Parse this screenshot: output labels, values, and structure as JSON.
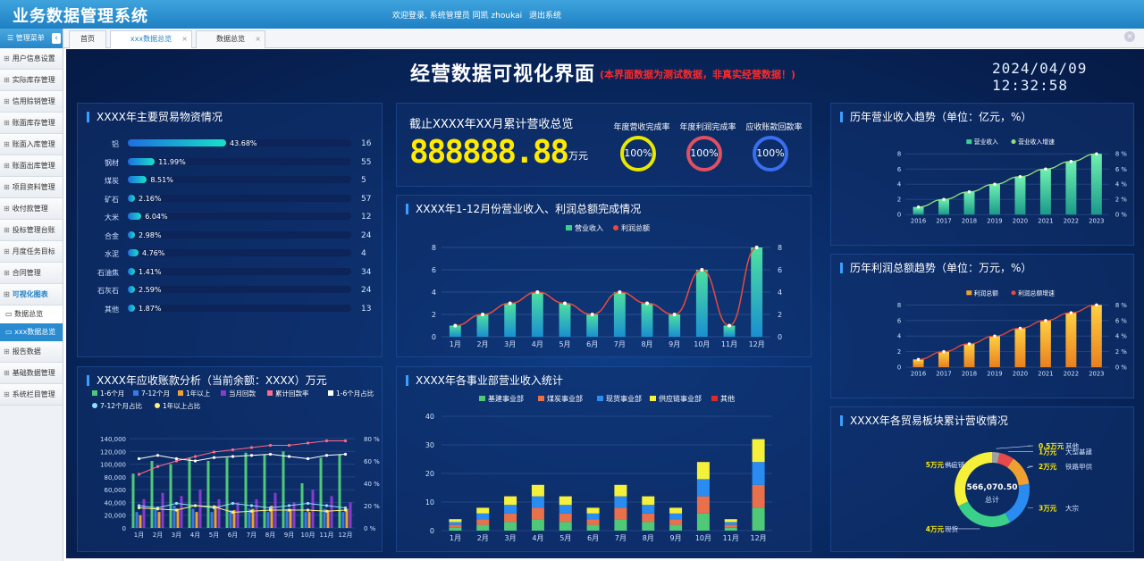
{
  "app": {
    "title": "业务数据管理系统",
    "welcome": "欢迎登录, 系统管理员 同凯 zhoukai",
    "logout": "退出系统"
  },
  "sidebar": {
    "header": "管理菜单",
    "collapse_icon": "chevron-left-icon",
    "items": [
      {
        "label": "用户信息设置"
      },
      {
        "label": "实际库存管理"
      },
      {
        "label": "信用赊销管理"
      },
      {
        "label": "账面库存管理"
      },
      {
        "label": "账面入库管理"
      },
      {
        "label": "账面出库管理"
      },
      {
        "label": "项目资料管理"
      },
      {
        "label": "收付款管理"
      },
      {
        "label": "投标管理台账"
      },
      {
        "label": "月度任务目标"
      },
      {
        "label": "合同管理"
      },
      {
        "label": "可视化图表"
      }
    ],
    "subitems": [
      {
        "label": "数据总览"
      },
      {
        "label": "xxx数据总览"
      }
    ],
    "items_after": [
      {
        "label": "报告数据"
      },
      {
        "label": "基础数据管理"
      },
      {
        "label": "系统栏目管理"
      }
    ]
  },
  "tabs": [
    {
      "label": "首页"
    },
    {
      "label": "xxx数据总览"
    },
    {
      "label": "数据总览"
    }
  ],
  "dashboard": {
    "title": "经营数据可视化界面",
    "note": "(本界面数据为测试数据，非真实经营数据！)",
    "datetime": "2024/04/09 12:32:58"
  },
  "materials": {
    "title": "XXXX年主要贸易物资情况",
    "rows": [
      {
        "name": "铝",
        "pct": 43.68,
        "pct_label": "43.68%",
        "count": "16"
      },
      {
        "name": "钢材",
        "pct": 11.99,
        "pct_label": "11.99%",
        "count": "55"
      },
      {
        "name": "煤炭",
        "pct": 8.51,
        "pct_label": "8.51%",
        "count": "5"
      },
      {
        "name": "矿石",
        "pct": 2.16,
        "pct_label": "2.16%",
        "count": "57"
      },
      {
        "name": "大米",
        "pct": 6.04,
        "pct_label": "6.04%",
        "count": "12"
      },
      {
        "name": "合金",
        "pct": 2.98,
        "pct_label": "2.98%",
        "count": "24"
      },
      {
        "name": "水泥",
        "pct": 4.76,
        "pct_label": "4.76%",
        "count": "4"
      },
      {
        "name": "石油焦",
        "pct": 1.41,
        "pct_label": "1.41%",
        "count": "34"
      },
      {
        "name": "石灰石",
        "pct": 2.59,
        "pct_label": "2.59%",
        "count": "24"
      },
      {
        "name": "其他",
        "pct": 1.87,
        "pct_label": "1.87%",
        "count": "13"
      }
    ]
  },
  "summary": {
    "label": "截止XXXX年XX月累计营收总览",
    "value": "888888.88",
    "unit": "万元",
    "rings": [
      {
        "label": "年度营收完成率",
        "value": "100%",
        "color": "#e8e800"
      },
      {
        "label": "年度利润完成率",
        "value": "100%",
        "color": "#e05060"
      },
      {
        "label": "应收账款回款率",
        "value": "100%",
        "color": "#3a6ef0"
      }
    ]
  },
  "chart_data": [
    {
      "type": "bar",
      "id": "monthly",
      "title": "XXXX年1-12月份营业收入、利润总额完成情况",
      "categories": [
        "1月",
        "2月",
        "3月",
        "4月",
        "5月",
        "6月",
        "7月",
        "8月",
        "9月",
        "10月",
        "11月",
        "12月"
      ],
      "series": [
        {
          "name": "营业收入",
          "type": "bar",
          "values": [
            1,
            2,
            3,
            4,
            3,
            2,
            4,
            3,
            2,
            6,
            1,
            8
          ]
        },
        {
          "name": "利润总额",
          "type": "line",
          "values": [
            1,
            2,
            3,
            4,
            3,
            2,
            4,
            3,
            2,
            6,
            1,
            8
          ]
        }
      ],
      "ylim": [
        0,
        8
      ],
      "yticks": [
        0,
        2,
        4,
        6,
        8
      ],
      "y2ticks": [
        0,
        2,
        4,
        6,
        8
      ],
      "legend": "top"
    },
    {
      "type": "bar",
      "id": "revenue_trend",
      "title": "历年营业收入趋势（单位：亿元，%）",
      "categories": [
        "2016",
        "2017",
        "2018",
        "2019",
        "2020",
        "2021",
        "2022",
        "2023"
      ],
      "series": [
        {
          "name": "营业收入",
          "type": "bar",
          "values": [
            1,
            2,
            3,
            4,
            5,
            6,
            7,
            8
          ]
        },
        {
          "name": "营业收入增速",
          "type": "line",
          "values": [
            1,
            2,
            3,
            4,
            5,
            6,
            7,
            8
          ]
        }
      ],
      "ylim": [
        0,
        8
      ],
      "yticks": [
        0,
        2,
        4,
        6,
        8
      ],
      "y2ticks": [
        "0 %",
        "2 %",
        "4 %",
        "6 %",
        "8 %"
      ],
      "legend": "top"
    },
    {
      "type": "bar",
      "id": "profit_trend",
      "title": "历年利润总额趋势（单位：万元，%）",
      "categories": [
        "2016",
        "2017",
        "2018",
        "2019",
        "2020",
        "2021",
        "2022",
        "2023"
      ],
      "series": [
        {
          "name": "利润总额",
          "type": "bar",
          "values": [
            1,
            2,
            3,
            4,
            5,
            6,
            7,
            8
          ]
        },
        {
          "name": "利润总额增速",
          "type": "line",
          "values": [
            1,
            2,
            3,
            4,
            5,
            6,
            7,
            8
          ]
        }
      ],
      "ylim": [
        0,
        8
      ],
      "yticks": [
        0,
        2,
        4,
        6,
        8
      ],
      "y2ticks": [
        "0 %",
        "2 %",
        "4 %",
        "6 %",
        "8 %"
      ],
      "legend": "top"
    },
    {
      "type": "bar",
      "id": "receivables",
      "title": "XXXX年应收账款分析（当前余额：XXXX）万元",
      "categories": [
        "1月",
        "2月",
        "3月",
        "4月",
        "5月",
        "6月",
        "7月",
        "8月",
        "9月",
        "10月",
        "11月",
        "12月"
      ],
      "series": [
        {
          "name": "1-6个月",
          "type": "bar",
          "color": "#4fc978",
          "values": [
            85000,
            105000,
            100000,
            110000,
            105000,
            110000,
            118000,
            115000,
            120000,
            70000,
            110000,
            115000
          ]
        },
        {
          "name": "7-12个月",
          "type": "bar",
          "color": "#3a78e6",
          "values": [
            25000,
            30000,
            35000,
            30000,
            25000,
            28000,
            30000,
            25000,
            30000,
            25000,
            30000,
            25000
          ]
        },
        {
          "name": "1年以上",
          "type": "bar",
          "color": "#f0a030",
          "values": [
            20000,
            25000,
            30000,
            25000,
            35000,
            28000,
            30000,
            35000,
            30000,
            25000,
            28000,
            30000
          ]
        },
        {
          "name": "当月回款",
          "type": "bar",
          "color": "#8a3ad0",
          "values": [
            45000,
            55000,
            50000,
            60000,
            45000,
            40000,
            45000,
            55000,
            40000,
            60000,
            50000,
            40000
          ]
        },
        {
          "name": "累计回款率",
          "type": "line",
          "color": "#ff6a8a",
          "values": [
            48,
            55,
            60,
            64,
            68,
            70,
            72,
            74,
            74,
            76,
            78,
            78
          ]
        },
        {
          "name": "1-6个月占比",
          "type": "line",
          "color": "#ffffff",
          "values": [
            62,
            65,
            62,
            60,
            63,
            64,
            65,
            66,
            64,
            62,
            65,
            66
          ]
        },
        {
          "name": "7-12个月占比",
          "type": "line",
          "color": "#8fe0ff",
          "values": [
            20,
            18,
            22,
            20,
            18,
            22,
            20,
            18,
            20,
            22,
            20,
            18
          ]
        },
        {
          "name": "1年以上占比",
          "type": "line",
          "color": "#fff080",
          "values": [
            18,
            17,
            16,
            20,
            19,
            14,
            15,
            16,
            16,
            16,
            15,
            16
          ]
        }
      ],
      "ylim": [
        0,
        140000
      ],
      "yticks": [
        "0",
        "20,000",
        "40,000",
        "60,000",
        "80,000",
        "100,000",
        "120,000",
        "140,000"
      ],
      "y2ticks": [
        "0 %",
        "20 %",
        "40 %",
        "60 %",
        "80 %"
      ],
      "legend": "top"
    },
    {
      "type": "bar",
      "stacked": true,
      "id": "divisions",
      "title": "XXXX年各事业部营业收入统计",
      "categories": [
        "1月",
        "2月",
        "3月",
        "4月",
        "5月",
        "6月",
        "7月",
        "8月",
        "9月",
        "10月",
        "11月",
        "12月"
      ],
      "series": [
        {
          "name": "基建事业部",
          "color": "#4fc978",
          "values": [
            1,
            2,
            3,
            4,
            3,
            2,
            4,
            3,
            2,
            6,
            1,
            8
          ]
        },
        {
          "name": "煤炭事业部",
          "color": "#e8704a",
          "values": [
            1,
            2,
            3,
            4,
            3,
            2,
            4,
            3,
            2,
            6,
            1,
            8
          ]
        },
        {
          "name": "现货事业部",
          "color": "#2a8bf0",
          "values": [
            1,
            2,
            3,
            4,
            3,
            2,
            4,
            3,
            2,
            6,
            1,
            8
          ]
        },
        {
          "name": "供应链事业部",
          "color": "#f5f03a",
          "values": [
            1,
            2,
            3,
            4,
            3,
            2,
            4,
            3,
            2,
            6,
            1,
            8
          ]
        },
        {
          "name": "其他",
          "color": "#e02a2a",
          "values": [
            0,
            0,
            0,
            0,
            0,
            0,
            0,
            0,
            0,
            0,
            0,
            0
          ]
        }
      ],
      "ylim": [
        0,
        40
      ],
      "yticks": [
        0,
        10,
        20,
        30,
        40
      ],
      "legend": "top"
    },
    {
      "type": "pie",
      "id": "segments",
      "title": "XXXX年各贸易板块累计营收情况",
      "center_value": "566,070.50",
      "center_label": "总计",
      "slices": [
        {
          "name": "其他",
          "label": "0.5万元",
          "value": 0.5,
          "color": "#a0a0a0"
        },
        {
          "name": "大型基建",
          "label": "1万元",
          "value": 1,
          "color": "#e84a4a"
        },
        {
          "name": "铁路甲供",
          "label": "2万元",
          "value": 2,
          "color": "#f0a030"
        },
        {
          "name": "大宗",
          "label": "3万元",
          "value": 3,
          "color": "#2a8bf0"
        },
        {
          "name": "现货",
          "label": "4万元",
          "value": 4,
          "color": "#3ad08a"
        },
        {
          "name": "供应链",
          "label": "5万元",
          "value": 5,
          "color": "#f5f03a"
        }
      ]
    }
  ]
}
